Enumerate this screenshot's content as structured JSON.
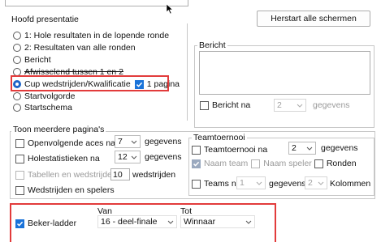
{
  "colors": {
    "accent": "#1a73d9",
    "highlight": "#e23b3b"
  },
  "hoofd": {
    "title": "Hoofd presentatie",
    "options": [
      "1: Hole resultaten in de lopende ronde",
      "2: Resultaten van alle ronden",
      "Bericht",
      "Afwisselend tussen 1 en 2",
      "Cup wedstrijden/Kwalificatie",
      "Startvolgorde",
      "Startschema"
    ],
    "selected_index": 4,
    "pagina_label": "1 pagina",
    "pagina_checked": true
  },
  "restart_button": "Herstart alle schermen",
  "bericht": {
    "title": "Bericht",
    "na_label": "Bericht na",
    "na_value": "2",
    "gegevens": "gegevens"
  },
  "toon": {
    "title": "Toon meerdere pagina's",
    "openvolgende_label": "Openvolgende aces na",
    "openvolgende_value": "7",
    "holestat_label": "Holestatistieken na",
    "holestat_value": "12",
    "tabellen_label": "Tabellen en wedstrijden",
    "tabellen_value": "10",
    "tabellen_suffix": "wedstrijden",
    "wedstrijden_label": "Wedstrijden en spelers",
    "gegevens": "gegevens"
  },
  "team": {
    "title": "Teamtoernooi",
    "na_label": "Teamtoernooi na",
    "na_value": "2",
    "gegevens": "gegevens",
    "naam_team": "Naam team",
    "naam_speler": "Naam speler",
    "ronden": "Ronden",
    "teams_na_label": "Teams na",
    "teams_na_value": "1",
    "teams_gegevens": "gegevens",
    "kolommen_value": "2",
    "kolommen_label": "Kolommen"
  },
  "beker": {
    "van_label": "Van",
    "tot_label": "Tot",
    "ladder_label": "Beker-ladder",
    "ladder_checked": true,
    "van_value": "16 - deel-finale",
    "tot_value": "Winnaar"
  }
}
